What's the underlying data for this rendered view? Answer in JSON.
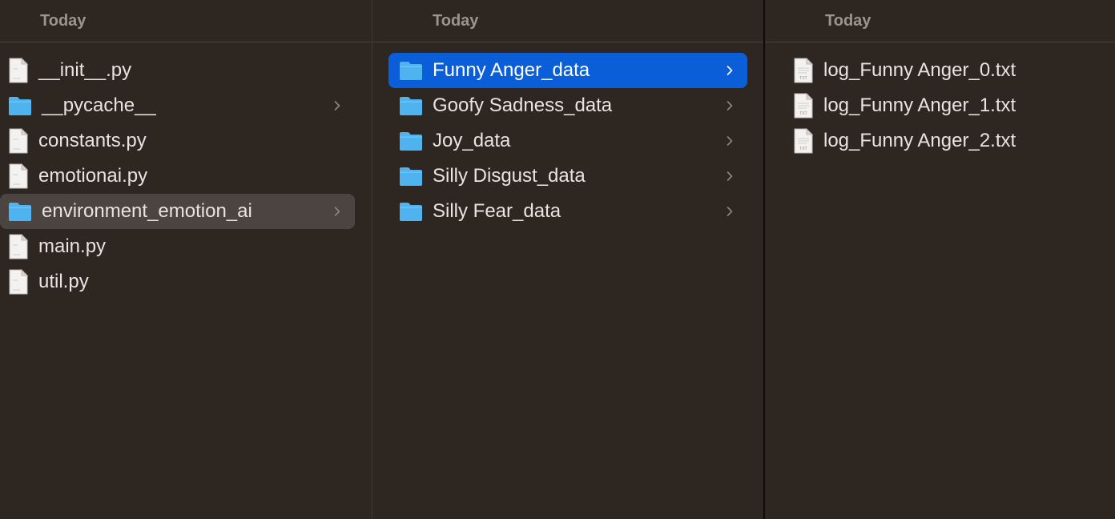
{
  "columns": [
    {
      "header": "Today",
      "items": [
        {
          "label": "__init__.py",
          "kind": "file",
          "icon": "python-file-icon",
          "has_children": false,
          "state": "normal"
        },
        {
          "label": "__pycache__",
          "kind": "folder",
          "icon": "folder-icon",
          "has_children": true,
          "state": "normal"
        },
        {
          "label": "constants.py",
          "kind": "file",
          "icon": "python-file-icon",
          "has_children": false,
          "state": "normal"
        },
        {
          "label": "emotionai.py",
          "kind": "file",
          "icon": "python-file-icon",
          "has_children": false,
          "state": "normal"
        },
        {
          "label": "environment_emotion_ai",
          "kind": "folder",
          "icon": "folder-icon",
          "has_children": true,
          "state": "path-selected"
        },
        {
          "label": "main.py",
          "kind": "file",
          "icon": "python-file-icon",
          "has_children": false,
          "state": "normal"
        },
        {
          "label": "util.py",
          "kind": "file",
          "icon": "python-file-icon",
          "has_children": false,
          "state": "normal"
        }
      ]
    },
    {
      "header": "Today",
      "items": [
        {
          "label": "Funny Anger_data",
          "kind": "folder",
          "icon": "folder-icon",
          "has_children": true,
          "state": "selected"
        },
        {
          "label": "Goofy Sadness_data",
          "kind": "folder",
          "icon": "folder-icon",
          "has_children": true,
          "state": "normal"
        },
        {
          "label": "Joy_data",
          "kind": "folder",
          "icon": "folder-icon",
          "has_children": true,
          "state": "normal"
        },
        {
          "label": "Silly Disgust_data",
          "kind": "folder",
          "icon": "folder-icon",
          "has_children": true,
          "state": "normal"
        },
        {
          "label": "Silly Fear_data",
          "kind": "folder",
          "icon": "folder-icon",
          "has_children": true,
          "state": "normal"
        }
      ]
    },
    {
      "header": "Today",
      "items": [
        {
          "label": "log_Funny Anger_0.txt",
          "kind": "file",
          "icon": "text-file-icon",
          "has_children": false,
          "state": "normal"
        },
        {
          "label": "log_Funny Anger_1.txt",
          "kind": "file",
          "icon": "text-file-icon",
          "has_children": false,
          "state": "normal"
        },
        {
          "label": "log_Funny Anger_2.txt",
          "kind": "file",
          "icon": "text-file-icon",
          "has_children": false,
          "state": "normal"
        }
      ]
    }
  ],
  "colors": {
    "background": "#2e2621",
    "selection": "#0a5fd8",
    "path_selection": "#4b4440",
    "folder": "#4fb3f0",
    "text": "#e8e4e1",
    "header_text": "#9b948f"
  }
}
